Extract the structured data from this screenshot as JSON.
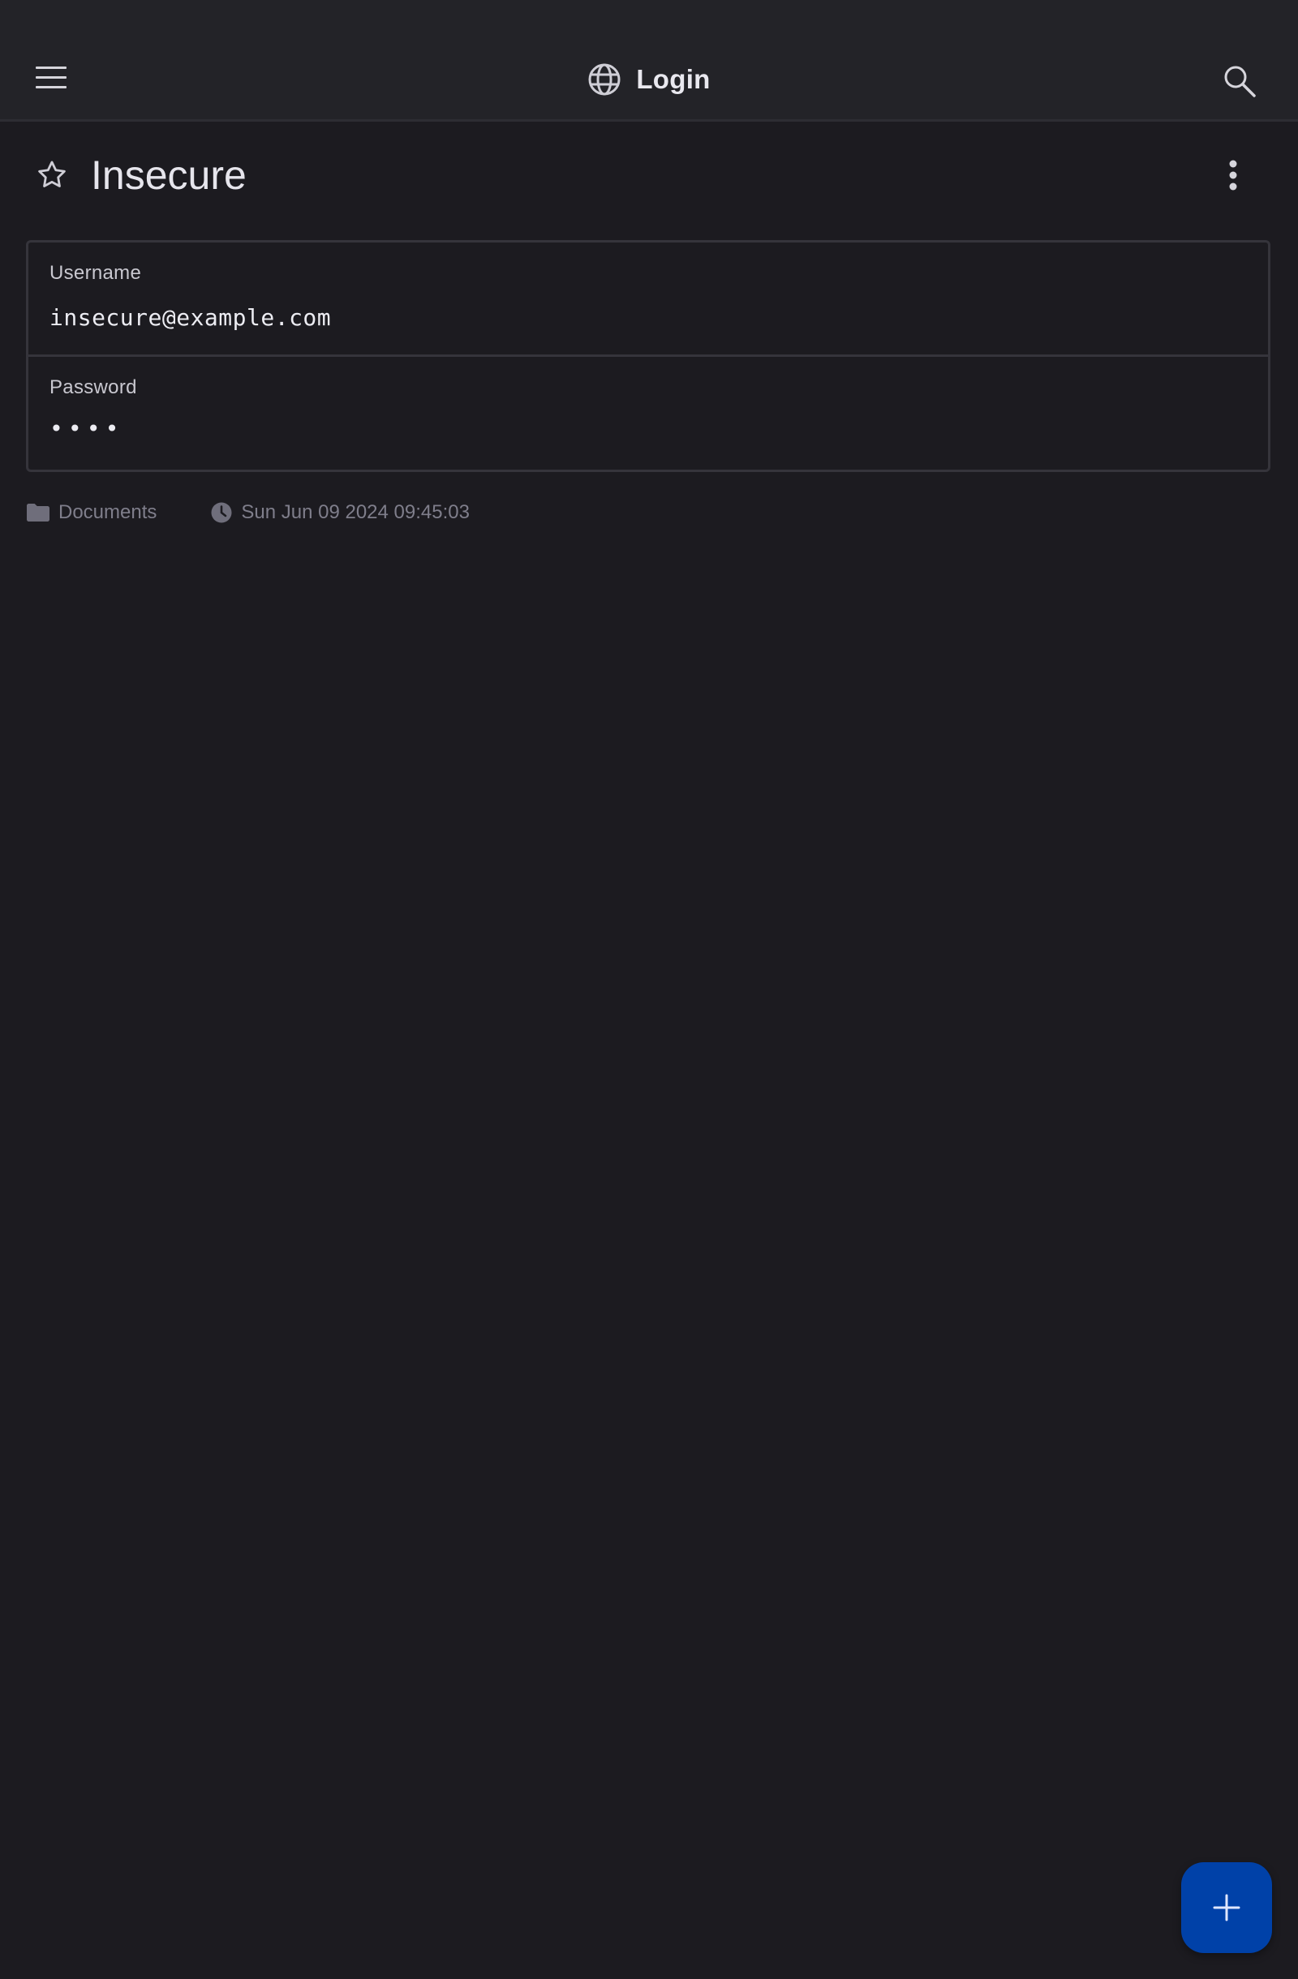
{
  "header": {
    "title": "Login",
    "menu_icon": "hamburger-menu-icon",
    "title_icon": "globe-icon",
    "search_icon": "search-icon"
  },
  "entry": {
    "title": "Insecure",
    "favorite_icon": "star-outline-icon",
    "more_icon": "more-vertical-icon",
    "fields": [
      {
        "label": "Username",
        "value": "insecure@example.com"
      },
      {
        "label": "Password",
        "value": "••••"
      }
    ],
    "meta": {
      "folder": "Documents",
      "modified": "Sun Jun 09 2024 09:45:03"
    }
  },
  "fab": {
    "icon": "plus-icon"
  },
  "colors": {
    "background": "#1c1b20",
    "topbar": "#232328",
    "fab": "#0041a8",
    "meta_text": "#7f7e8b"
  }
}
